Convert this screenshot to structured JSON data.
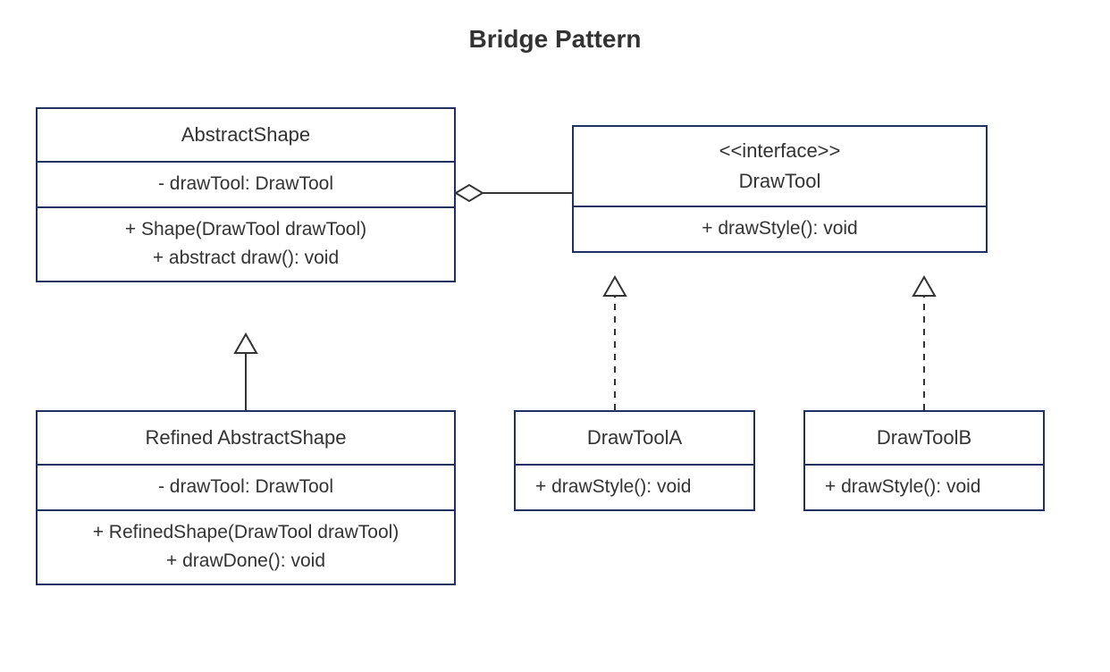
{
  "title": "Bridge Pattern",
  "classes": {
    "abstractShape": {
      "name": "AbstractShape",
      "attr1": "-  drawTool: DrawTool",
      "op1": "+ Shape(DrawTool drawTool)",
      "op2": "+  abstract draw(): void"
    },
    "refinedShape": {
      "name": "Refined AbstractShape",
      "attr1": "-  drawTool: DrawTool",
      "op1": "+ RefinedShape(DrawTool drawTool)",
      "op2": "+  drawDone(): void"
    },
    "drawTool": {
      "stereotype": "<<interface>>",
      "name": "DrawTool",
      "op1": "+   drawStyle(): void"
    },
    "drawToolA": {
      "name": "DrawToolA",
      "op1": "+   drawStyle(): void"
    },
    "drawToolB": {
      "name": "DrawToolB",
      "op1": "+   drawStyle(): void"
    }
  },
  "relations": [
    {
      "type": "aggregation",
      "from": "DrawTool",
      "to": "AbstractShape"
    },
    {
      "type": "generalization",
      "from": "Refined AbstractShape",
      "to": "AbstractShape"
    },
    {
      "type": "realization",
      "from": "DrawToolA",
      "to": "DrawTool"
    },
    {
      "type": "realization",
      "from": "DrawToolB",
      "to": "DrawTool"
    }
  ]
}
